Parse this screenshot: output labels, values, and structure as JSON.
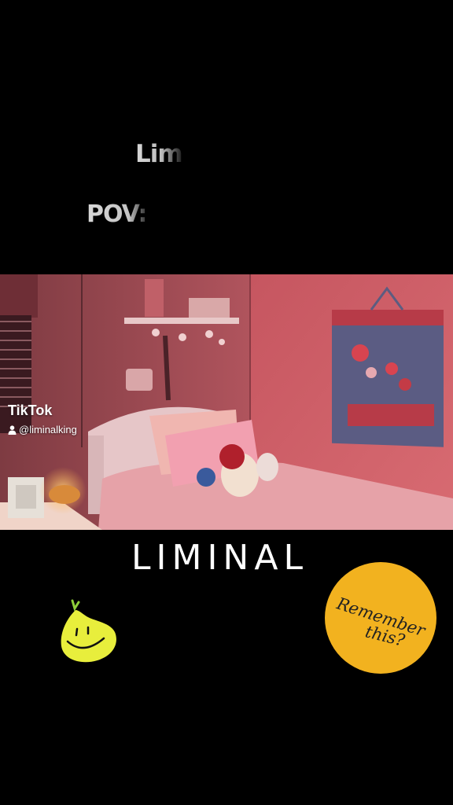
{
  "captions": {
    "top_partial": "Lim",
    "pov_partial": "POV:"
  },
  "overlay": {
    "watermark_brand": "TikTok",
    "username": "@liminalking",
    "icons": [
      "tiktok-logo-icon",
      "user-icon"
    ]
  },
  "title": {
    "text": "LIMINAL"
  },
  "badge": {
    "line1": "Remember",
    "line2": "this?",
    "color": "#f2b21f"
  },
  "stickers": {
    "pear": "smiling-pear-icon"
  },
  "colors": {
    "background": "#000000",
    "room_light": "#c95a63"
  }
}
